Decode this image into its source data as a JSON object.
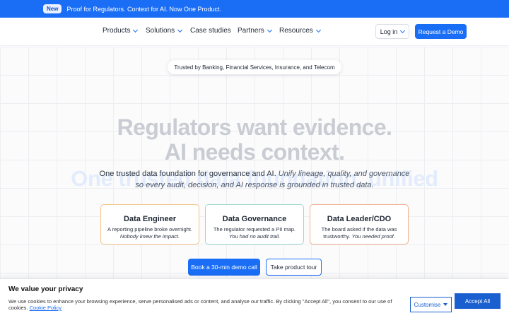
{
  "banner": {
    "badge": "New",
    "text": "Proof for Regulators. Context for AI. Now One Product."
  },
  "nav": {
    "items": [
      {
        "label": "Products"
      },
      {
        "label": "Solutions"
      },
      {
        "label": "Case studies"
      },
      {
        "label": "Partners"
      },
      {
        "label": "Resources"
      }
    ],
    "login": "Log in",
    "demo": "Request a Demo"
  },
  "hero": {
    "trust": "Trusted by Banking, Financial Services, Insurance, and Telecom",
    "headline1": "Regulators want evidence.",
    "headline2": "AI needs context.",
    "ghost": "One trusted data foundation, unified",
    "sub_plain": "One trusted data foundation for governance and AI.",
    "sub_italic1": "Unify lineage, quality, and governance",
    "sub_italic2": "so every audit, decision, and AI response is grounded in trusted data."
  },
  "cards": [
    {
      "title": "Data Engineer",
      "line1": "A reporting pipeline broke overnight.",
      "line2": "Nobody knew the impact."
    },
    {
      "title": "Data Governance",
      "line1": "The regulator requested a PII map.",
      "line2": "You had no audit trail."
    },
    {
      "title": "Data Leader/CDO",
      "line1": "The board asked if the data was",
      "line1b": "trustworthy.",
      "line2": "You needed proof."
    }
  ],
  "cta": {
    "primary": "Book a 30-min demo call",
    "secondary": "Take product tour"
  },
  "cookie": {
    "title": "We value your privacy",
    "body": "We use cookies to enhance your browsing experience, serve personalised ads or content, and analyse our traffic. By clicking \"Accept All\", you consent to our use of cookies.",
    "link": "Cookie Policy",
    "customise": "Customise",
    "accept": "Accept All"
  },
  "colors": {
    "brand": "#1a6ef5",
    "headline": "#c9ccd2"
  }
}
